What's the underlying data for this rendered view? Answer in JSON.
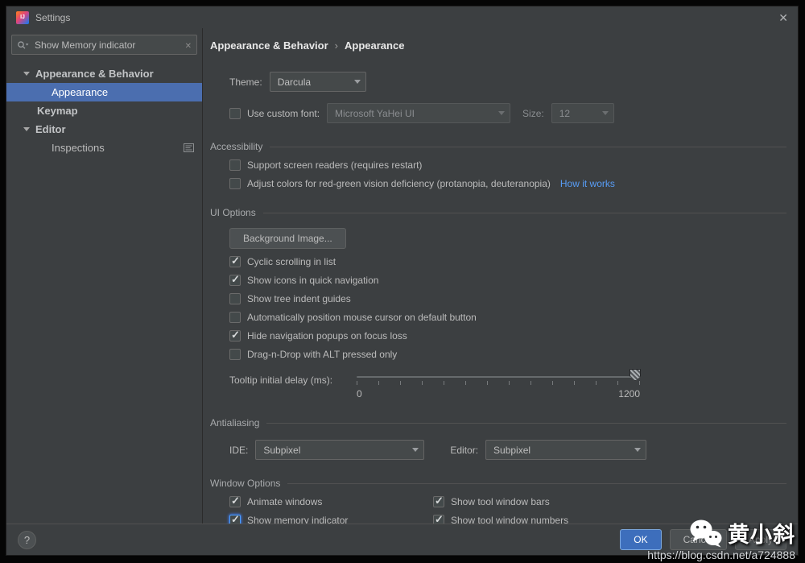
{
  "window": {
    "logo_text": "IJ",
    "title": "Settings",
    "close_symbol": "✕"
  },
  "sidebar": {
    "search_value": "Show Memory indicator",
    "items": [
      {
        "label": "Appearance & Behavior"
      },
      {
        "label": "Appearance"
      },
      {
        "label": "Keymap"
      },
      {
        "label": "Editor"
      },
      {
        "label": "Inspections"
      }
    ]
  },
  "main": {
    "breadcrumb": {
      "root": "Appearance & Behavior",
      "separator": "›",
      "current": "Appearance"
    },
    "theme": {
      "label": "Theme:",
      "value": "Darcula"
    },
    "custom_font": {
      "checked": false,
      "label": "Use custom font:",
      "font_value": "Microsoft YaHei UI",
      "size_label": "Size:",
      "size_value": "12"
    },
    "accessibility": {
      "title": "Accessibility",
      "screen_readers": {
        "checked": false,
        "label": "Support screen readers (requires restart)"
      },
      "color_adjust": {
        "checked": false,
        "label": "Adjust colors for red-green vision deficiency (protanopia, deuteranopia)",
        "link": "How it works"
      }
    },
    "ui_options": {
      "title": "UI Options",
      "background_image_button": "Background Image...",
      "checkboxes": [
        {
          "label": "Cyclic scrolling in list",
          "checked": true
        },
        {
          "label": "Show icons in quick navigation",
          "checked": true
        },
        {
          "label": "Show tree indent guides",
          "checked": false
        },
        {
          "label": "Automatically position mouse cursor on default button",
          "checked": false
        },
        {
          "label": "Hide navigation popups on focus loss",
          "checked": true
        },
        {
          "label": "Drag-n-Drop with ALT pressed only",
          "checked": false
        }
      ],
      "tooltip": {
        "label": "Tooltip initial delay (ms):",
        "min": "0",
        "max": "1200",
        "value": 1200
      }
    },
    "antialiasing": {
      "title": "Antialiasing",
      "ide_label": "IDE:",
      "ide_value": "Subpixel",
      "editor_label": "Editor:",
      "editor_value": "Subpixel"
    },
    "window_options": {
      "title": "Window Options",
      "checkboxes": [
        {
          "label": "Animate windows",
          "checked": true
        },
        {
          "label": "Show tool window bars",
          "checked": true
        },
        {
          "label": "Show memory indicator",
          "checked": true,
          "focused": true
        },
        {
          "label": "Show tool window numbers",
          "checked": true
        }
      ]
    }
  },
  "footer": {
    "help": "?",
    "ok": "OK",
    "cancel": "Cancel",
    "apply": "Apply"
  },
  "watermark": {
    "name": "黄小斜",
    "url": "https://blog.csdn.net/a724888"
  },
  "colors": {
    "selection": "#4b6eaf",
    "link": "#589df6",
    "primary_button": "#3d6ebc"
  }
}
